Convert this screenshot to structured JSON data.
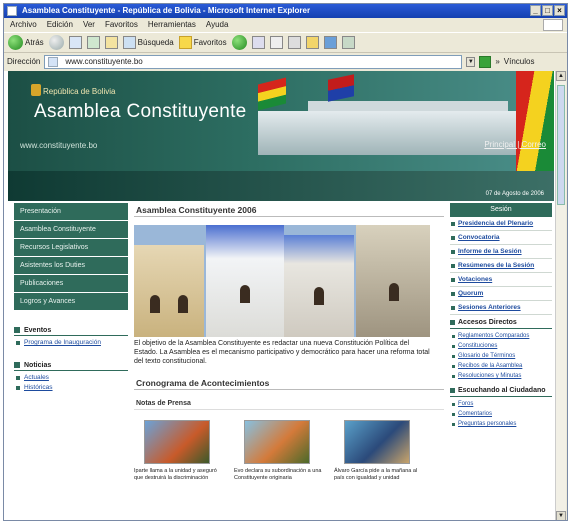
{
  "window": {
    "title": "Asamblea Constituyente - República de Bolivia - Microsoft Internet Explorer"
  },
  "menu": [
    "Archivo",
    "Edición",
    "Ver",
    "Favoritos",
    "Herramientas",
    "Ayuda"
  ],
  "toolbar": {
    "back": "Atrás",
    "search": "Búsqueda",
    "favorites": "Favoritos"
  },
  "address": {
    "label": "Dirección",
    "url": "www.constituyente.bo",
    "links": "Vínculos"
  },
  "header": {
    "republic": "República de Bolivia",
    "title": "Asamblea Constituyente",
    "url": "www.constituyente.bo",
    "links": "Principal | Correo",
    "date": "07 de Agosto de 2006"
  },
  "leftnav": {
    "items": [
      "Presentación",
      "Asamblea Constituyente",
      "Recursos Legislativos",
      "Asistentes los Duties",
      "Publicaciones",
      "Logros y Avances"
    ],
    "eventos_title": "Eventos",
    "eventos": [
      "Programa de Inauguración"
    ],
    "noticias_title": "Noticias",
    "noticias": [
      "Actuales",
      "Históricas"
    ]
  },
  "main": {
    "title": "Asamblea Constituyente 2006",
    "intro": "El objetivo de la Asamblea Constituyente es redactar una nueva Constitución Política del Estado. La Asamblea es el mecanismo participativo y democrático para hacer una reforma total del texto constitucional.",
    "title2": "Cronograma de Acontecimientos",
    "notas": "Notas de Prensa",
    "news": [
      {
        "caption": "Iparte llama a la unidad y aseguró que destruirá la discriminación"
      },
      {
        "caption": "Evo declara su subordinación a una Constituyente originaria"
      },
      {
        "caption": "Álvaro García pide a la mañana al país con igualdad y unidad"
      }
    ]
  },
  "right": {
    "session_title": "Sesión",
    "session": [
      "Presidencia del Plenario",
      "Convocatoria",
      "Informe de la Sesión",
      "Resúmenes de la Sesión",
      "Votaciones",
      "Quorum",
      "Sesiones Anteriores"
    ],
    "access_title": "Accesos Directos",
    "access": [
      "Reglamentos Comparados",
      "Constituciones",
      "Glosario de Términos",
      "Recibos de la Asamblea",
      "Resoluciones y Minutas"
    ],
    "citizen_title": "Escuchando al Ciudadano",
    "citizen": [
      "Foros",
      "Comentarios",
      "Preguntas personales"
    ]
  }
}
